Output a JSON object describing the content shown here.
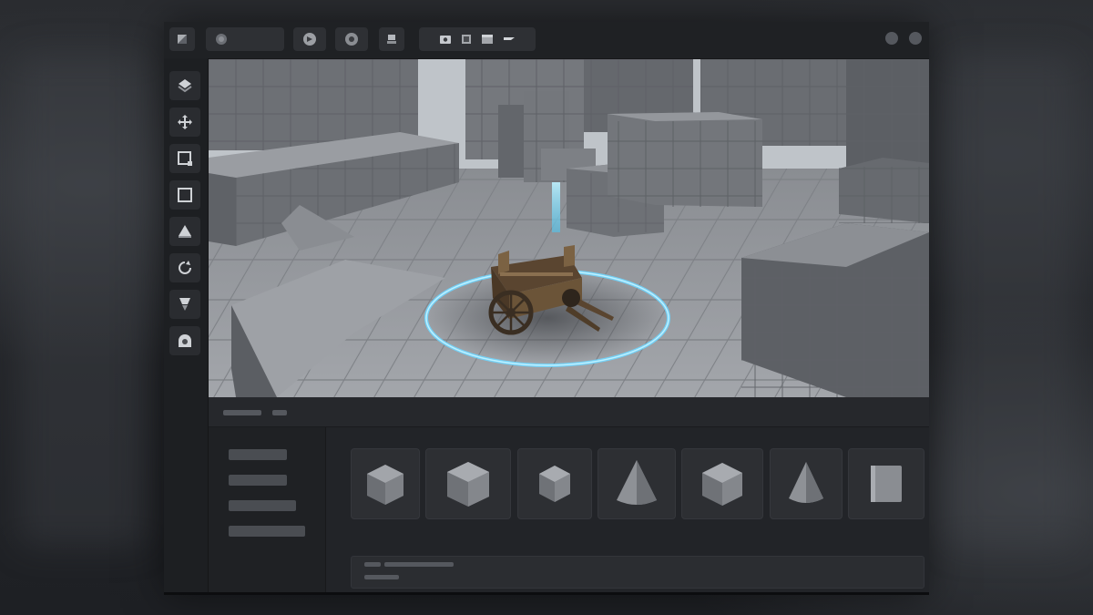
{
  "window": {
    "title": ""
  },
  "topbar": {
    "buttons": [
      "app-menu",
      "project-selector",
      "play",
      "record",
      "save",
      "view-modes",
      "window-minimize",
      "window-close"
    ]
  },
  "left_tools": {
    "items": [
      "select-tool",
      "move-tool",
      "scale-tool",
      "rect-tool",
      "terrain-tool",
      "rotate-tool",
      "paint-tool",
      "sculpt-tool"
    ]
  },
  "viewport": {
    "selected_object": "cart",
    "gizmo_color": "#6fd6ff",
    "floor_color": "#9a9da2",
    "block_color": "#6f7278"
  },
  "bottom_panel": {
    "tabs": [
      "",
      ""
    ],
    "categories": [
      "",
      "",
      "",
      ""
    ],
    "assets": [
      {
        "name": "",
        "shape": "cube"
      },
      {
        "name": "",
        "shape": "cube"
      },
      {
        "name": "",
        "shape": "cube-small"
      },
      {
        "name": "",
        "shape": "cone"
      },
      {
        "name": "",
        "shape": "cube"
      },
      {
        "name": "",
        "shape": "cone-small"
      },
      {
        "name": "",
        "shape": "panel"
      }
    ],
    "status": ""
  },
  "colors": {
    "accent": "#6fd6ff",
    "panel": "#24262a",
    "toolbar": "#1f2124"
  }
}
